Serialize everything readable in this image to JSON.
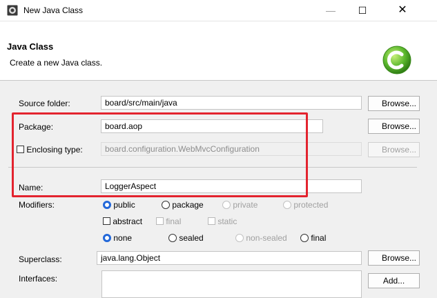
{
  "window": {
    "title": "New Java Class",
    "minimize_label": "—",
    "maximize_label": "☐",
    "close_label": "✕"
  },
  "header": {
    "title": "Java Class",
    "description": "Create a new Java class."
  },
  "source_folder": {
    "label": "Source folder:",
    "value": "board/src/main/java",
    "browse_label": "Browse..."
  },
  "package": {
    "label": "Package:",
    "value": "board.aop",
    "browse_label": "Browse..."
  },
  "enclosing_type": {
    "label": "Enclosing type:",
    "value": "board.configuration.WebMvcConfiguration",
    "browse_label": "Browse..."
  },
  "name": {
    "label": "Name:",
    "value": "LoggerAspect"
  },
  "modifiers": {
    "label": "Modifiers:",
    "access": [
      "public",
      "package",
      "private",
      "protected"
    ],
    "flags": [
      "abstract",
      "final",
      "static"
    ],
    "inheritance": [
      "none",
      "sealed",
      "non-sealed",
      "final"
    ]
  },
  "superclass": {
    "label": "Superclass:",
    "value": "java.lang.Object",
    "browse_label": "Browse..."
  },
  "interfaces": {
    "label": "Interfaces:",
    "add_label": "Add..."
  },
  "colors": {
    "highlight": "#e3232e",
    "accent": "#2368d9",
    "wizard_icon": "#5cb82e"
  }
}
